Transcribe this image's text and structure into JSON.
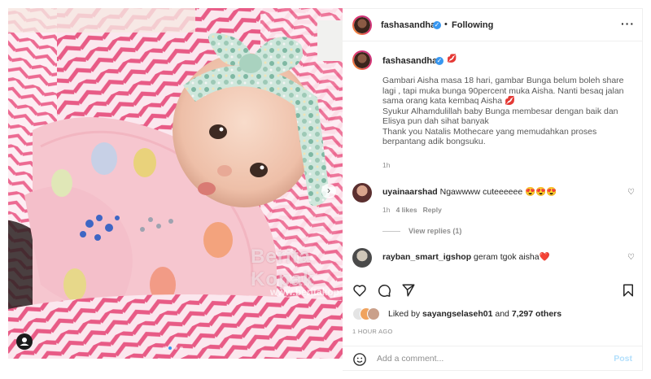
{
  "post_author": {
    "username": "fashasandha",
    "follow_status": "Following",
    "separator": "•",
    "more_icon": "more-horizontal-icon"
  },
  "caption": {
    "username": "fashasandha",
    "emoji": "💋",
    "lines": [
      "Gambari Aisha masa 18 hari, gambar Bunga belum boleh share",
      "lagi , tapi muka bunga 90percent muka Aisha. Nanti besaq jalan",
      "sama orang kata kembaq Aisha 💋",
      "Syukur Alhamdulillah baby Bunga membesar dengan baik dan",
      "Elisya pun dah sihat banyak",
      "Thank you Natalis Mothecare yang memudahkan proses",
      "berpantang adik bongsuku."
    ],
    "time": "1h"
  },
  "comments": [
    {
      "username": "uyainaarshad",
      "text": "Ngawwww cuteeeeee 😍😍😍",
      "time": "1h",
      "likes": "4 likes",
      "reply": "Reply"
    },
    {
      "username": "rayban_smart_igshop",
      "text": "geram tgok aisha❤️"
    }
  ],
  "view_replies": "View replies (1)",
  "liked_by": {
    "prefix": "Liked by",
    "user": "sayangselaseh01",
    "and": "and",
    "others": "7,297 others"
  },
  "time_ago": "1 HOUR AGO",
  "add_comment": {
    "placeholder": "Add a comment...",
    "post_label": "Post"
  },
  "watermark": {
    "line1": "Berita Kopak",
    "line2": "www.beritakopak.com"
  },
  "carousel": {
    "dots": 4,
    "active_index": 1
  },
  "colors": {
    "verified_blue": "#3897f0",
    "post_button": "#b2dffc",
    "heart_red": "#ed4956"
  }
}
